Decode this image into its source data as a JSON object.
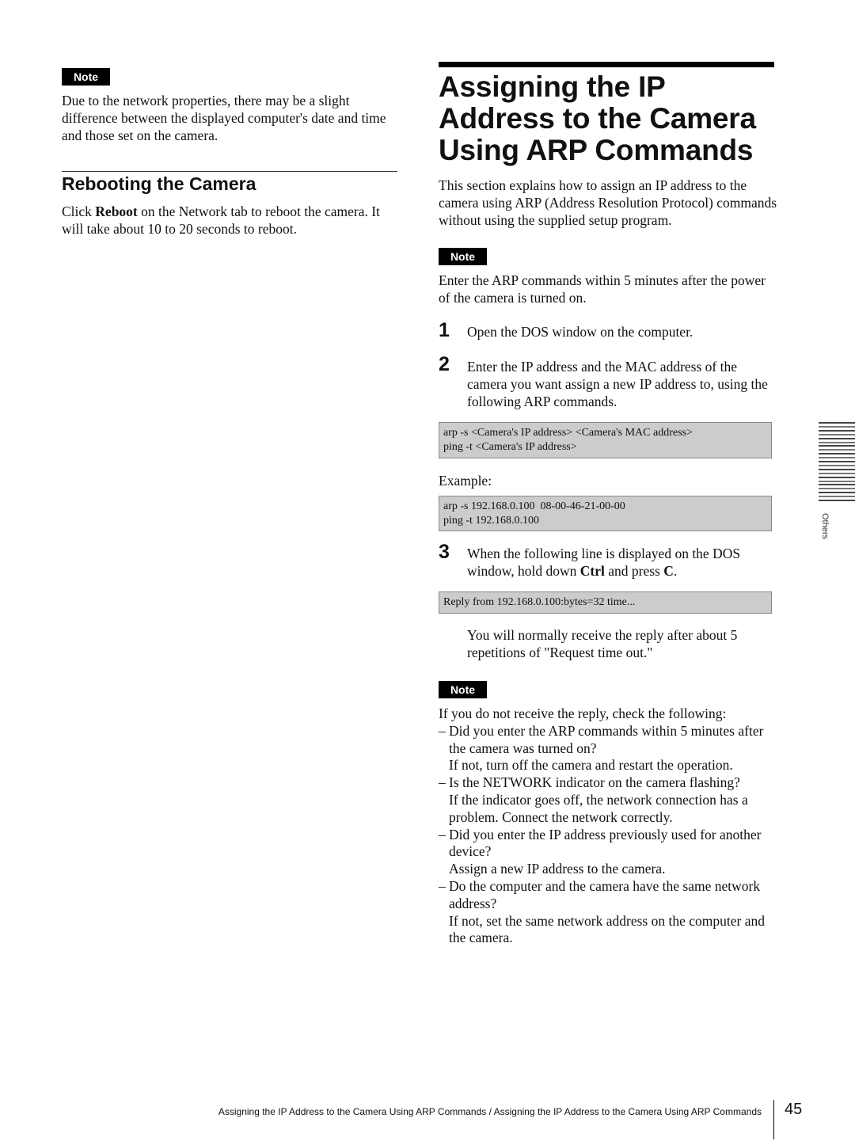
{
  "left_column": {
    "note": {
      "badge": "Note",
      "text": "Due to the network properties, there may be a slight difference between the displayed computer's date and time and those set on the camera."
    },
    "rebooting_section": {
      "heading": "Rebooting the Camera",
      "text_before_bold": "Click ",
      "bold": "Reboot",
      "text_after_bold": " on the Network tab to reboot the camera. It will take about 10 to 20 seconds to reboot."
    }
  },
  "right_column": {
    "title_lines": [
      "Assigning the IP",
      "Address to the Camera",
      "Using ARP Commands"
    ],
    "intro": "This section explains how to assign an IP address to the camera using ARP (Address Resolution Protocol) commands without using the supplied setup program.",
    "note1": {
      "badge": "Note",
      "text": "Enter the ARP commands within 5 minutes after the power of the camera is turned on."
    },
    "steps": [
      {
        "number": "1",
        "text": "Open the DOS window on the computer."
      },
      {
        "number": "2",
        "text": "Enter the IP address and the MAC address of the camera you want assign a new IP address to, using the following ARP commands."
      },
      {
        "number": "3",
        "text_before_ctrl": "When the following line is displayed on the DOS window, hold down ",
        "ctrl": "Ctrl",
        "text_mid": " and press ",
        "c": "C",
        "text_end": "."
      }
    ],
    "syntax_box": [
      "arp -s <Camera's IP address> <Camera's MAC address>",
      "ping -t <Camera's IP address>"
    ],
    "example_label": "Example:",
    "example_box": [
      "arp -s 192.168.0.100  08-00-46-21-00-00",
      "ping -t 192.168.0.100"
    ],
    "reply_box": "Reply from 192.168.0.100:bytes=32 time...",
    "reply_note": "You will normally receive the reply after about 5 repetitions of \"Request time out.\"",
    "note2": {
      "badge": "Note",
      "intro": "If you do not receive the reply, check the following:",
      "items": [
        {
          "dash": "–",
          "question": "Did you enter the ARP commands within 5 minutes after the camera was turned on?",
          "answer": "If not, turn off the camera and restart the operation."
        },
        {
          "dash": "–",
          "question": "Is the NETWORK indicator on the camera flashing?",
          "answer": "If the indicator goes off, the network connection has a problem.  Connect the network correctly."
        },
        {
          "dash": "–",
          "question": "Did you enter the IP address previously used for another device?",
          "answer": "Assign a new IP address to the camera."
        },
        {
          "dash": "–",
          "question": "Do the computer and the camera have the same network address?",
          "answer": "If not, set the same network address on the computer and the camera."
        }
      ]
    }
  },
  "side_tab": {
    "label": "Others"
  },
  "footer": {
    "running_text": "Assigning the IP Address to the Camera Using ARP Commands / Assigning the IP Address to the Camera Using ARP Commands",
    "page_number": "45"
  }
}
